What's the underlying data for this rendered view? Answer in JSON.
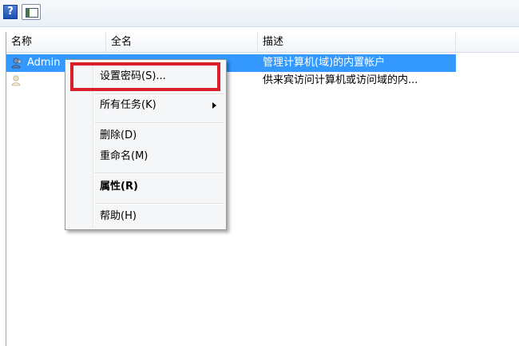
{
  "toolbar": {
    "help_icon": "help-icon",
    "help_glyph": "?",
    "panel_icon": "show-hide-pane-icon"
  },
  "columns": {
    "name": "名称",
    "full_name": "全名",
    "description": "描述"
  },
  "rows": [
    {
      "name": "Admin",
      "full_name": "",
      "description": "管理计算机(域)的内置帐户",
      "selected": true
    },
    {
      "name": "",
      "full_name": "",
      "description": "供来宾访问计算机或访问域的内...",
      "selected": false
    }
  ],
  "context_menu": {
    "items": [
      {
        "label": "设置密码(S)..."
      },
      {
        "label": "所有任务(K)",
        "submenu": true
      },
      {
        "label": "删除(D)"
      },
      {
        "label": "重命名(M)"
      },
      {
        "label": "属性(R)",
        "bold": true
      },
      {
        "label": "帮助(H)"
      }
    ]
  },
  "colors": {
    "selection": "#3399ff",
    "highlight_box": "#d9202a"
  }
}
